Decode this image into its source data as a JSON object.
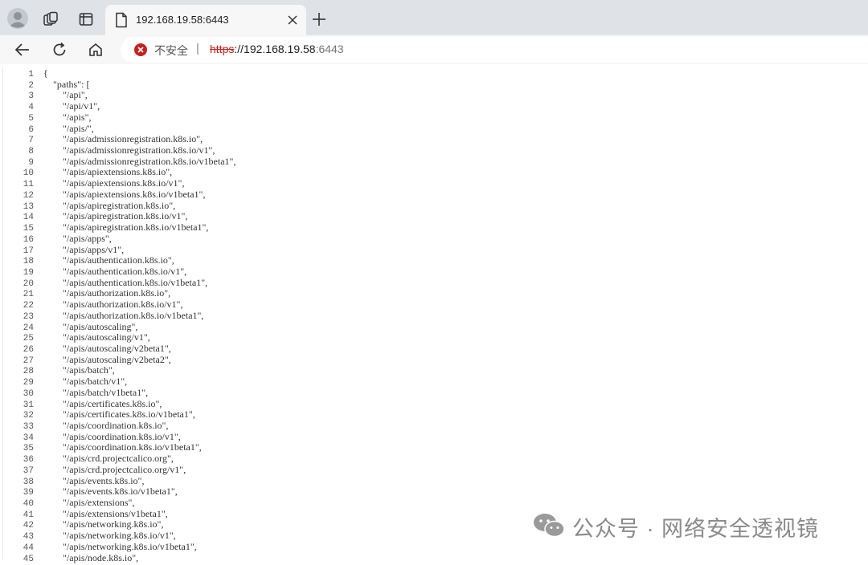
{
  "browser": {
    "tab": {
      "title": "192.168.19.58:6443"
    },
    "address": {
      "security_label": "不安全",
      "separator": "|",
      "scheme": "https",
      "scheme_sep": "://",
      "host": "192.168.19.58",
      "port": ":6443"
    }
  },
  "document": {
    "lines": [
      {
        "n": "1",
        "t": "{"
      },
      {
        "n": "2",
        "t": "    \"paths\": ["
      },
      {
        "n": "3",
        "t": "        \"/api\","
      },
      {
        "n": "4",
        "t": "        \"/api/v1\","
      },
      {
        "n": "5",
        "t": "        \"/apis\","
      },
      {
        "n": "6",
        "t": "        \"/apis/\","
      },
      {
        "n": "7",
        "t": "        \"/apis/admissionregistration.k8s.io\","
      },
      {
        "n": "8",
        "t": "        \"/apis/admissionregistration.k8s.io/v1\","
      },
      {
        "n": "9",
        "t": "        \"/apis/admissionregistration.k8s.io/v1beta1\","
      },
      {
        "n": "10",
        "t": "        \"/apis/apiextensions.k8s.io\","
      },
      {
        "n": "11",
        "t": "        \"/apis/apiextensions.k8s.io/v1\","
      },
      {
        "n": "12",
        "t": "        \"/apis/apiextensions.k8s.io/v1beta1\","
      },
      {
        "n": "13",
        "t": "        \"/apis/apiregistration.k8s.io\","
      },
      {
        "n": "14",
        "t": "        \"/apis/apiregistration.k8s.io/v1\","
      },
      {
        "n": "15",
        "t": "        \"/apis/apiregistration.k8s.io/v1beta1\","
      },
      {
        "n": "16",
        "t": "        \"/apis/apps\","
      },
      {
        "n": "17",
        "t": "        \"/apis/apps/v1\","
      },
      {
        "n": "18",
        "t": "        \"/apis/authentication.k8s.io\","
      },
      {
        "n": "19",
        "t": "        \"/apis/authentication.k8s.io/v1\","
      },
      {
        "n": "20",
        "t": "        \"/apis/authentication.k8s.io/v1beta1\","
      },
      {
        "n": "21",
        "t": "        \"/apis/authorization.k8s.io\","
      },
      {
        "n": "22",
        "t": "        \"/apis/authorization.k8s.io/v1\","
      },
      {
        "n": "23",
        "t": "        \"/apis/authorization.k8s.io/v1beta1\","
      },
      {
        "n": "24",
        "t": "        \"/apis/autoscaling\","
      },
      {
        "n": "25",
        "t": "        \"/apis/autoscaling/v1\","
      },
      {
        "n": "26",
        "t": "        \"/apis/autoscaling/v2beta1\","
      },
      {
        "n": "27",
        "t": "        \"/apis/autoscaling/v2beta2\","
      },
      {
        "n": "28",
        "t": "        \"/apis/batch\","
      },
      {
        "n": "29",
        "t": "        \"/apis/batch/v1\","
      },
      {
        "n": "30",
        "t": "        \"/apis/batch/v1beta1\","
      },
      {
        "n": "31",
        "t": "        \"/apis/certificates.k8s.io\","
      },
      {
        "n": "32",
        "t": "        \"/apis/certificates.k8s.io/v1beta1\","
      },
      {
        "n": "33",
        "t": "        \"/apis/coordination.k8s.io\","
      },
      {
        "n": "34",
        "t": "        \"/apis/coordination.k8s.io/v1\","
      },
      {
        "n": "35",
        "t": "        \"/apis/coordination.k8s.io/v1beta1\","
      },
      {
        "n": "36",
        "t": "        \"/apis/crd.projectcalico.org\","
      },
      {
        "n": "37",
        "t": "        \"/apis/crd.projectcalico.org/v1\","
      },
      {
        "n": "38",
        "t": "        \"/apis/events.k8s.io\","
      },
      {
        "n": "39",
        "t": "        \"/apis/events.k8s.io/v1beta1\","
      },
      {
        "n": "40",
        "t": "        \"/apis/extensions\","
      },
      {
        "n": "41",
        "t": "        \"/apis/extensions/v1beta1\","
      },
      {
        "n": "42",
        "t": "        \"/apis/networking.k8s.io\","
      },
      {
        "n": "43",
        "t": "        \"/apis/networking.k8s.io/v1\","
      },
      {
        "n": "44",
        "t": "        \"/apis/networking.k8s.io/v1beta1\","
      },
      {
        "n": "45",
        "t": "        \"/apis/node.k8s.io\","
      }
    ]
  },
  "watermark": {
    "text": "公众号 · 网络安全透视镜"
  },
  "colors": {
    "tabbar_bg": "#dfe3e8",
    "toolbar_bg": "#f7f7f7",
    "insecure_red": "#c5221f"
  }
}
